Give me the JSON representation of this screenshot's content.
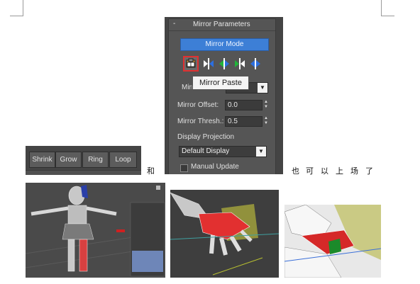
{
  "panel": {
    "title": "Mirror Parameters",
    "collapse_symbol": "-",
    "mirror_mode_label": "Mirror Mode",
    "tooltip": "Mirror Paste",
    "mirror_label_partial": "Mirr",
    "mirror_offset_label": "Mirror Offset:",
    "mirror_offset_value": "0.0",
    "mirror_thresh_label": "Mirror Thresh.:",
    "mirror_thresh_value": "0.5",
    "display_projection_label": "Display Projection",
    "display_projection_value": "Default Display",
    "manual_update_label": "Manual Update"
  },
  "toolbar": {
    "shrink": "Shrink",
    "grow": "Grow",
    "ring": "Ring",
    "loop": "Loop"
  },
  "text": {
    "he": "和",
    "ye": "也",
    "ke": "可",
    "yi": "以",
    "shang": "上",
    "chang": "场",
    "le": "了"
  },
  "colors": {
    "accent_blue": "#3d7fd6",
    "highlight_red": "#e03030",
    "panel_bg": "#555555"
  }
}
